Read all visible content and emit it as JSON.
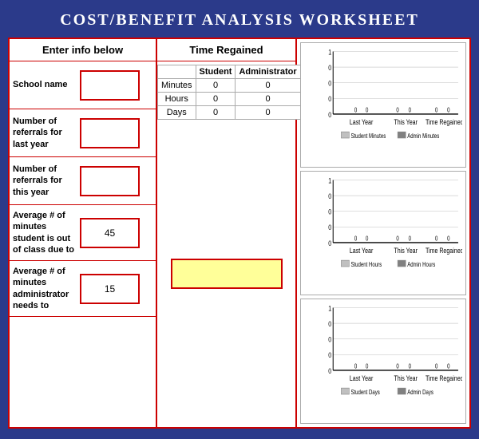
{
  "title": "COST/BENEFIT ANALYSIS WORKSHEET",
  "left_panel": {
    "header": "Enter info below",
    "fields": [
      {
        "label": "School name",
        "value": "",
        "has_input": true
      },
      {
        "label": "Number of referrals for last year",
        "value": "",
        "has_input": true
      },
      {
        "label": "Number of referrals for this year",
        "value": "",
        "has_input": true
      },
      {
        "label": "Average # of minutes student is out of class due to",
        "value": "45",
        "has_input": false
      },
      {
        "label": "Average # of minutes administrator needs to",
        "value": "15",
        "has_input": false
      }
    ]
  },
  "middle_panel": {
    "header": "Time Regained",
    "table": {
      "headers": [
        "",
        "Student",
        "Administrator"
      ],
      "rows": [
        {
          "label": "Minutes",
          "student": "0",
          "admin": "0"
        },
        {
          "label": "Hours",
          "student": "0",
          "admin": "0"
        },
        {
          "label": "Days",
          "student": "0",
          "admin": "0"
        }
      ]
    }
  },
  "charts": [
    {
      "id": "minutes-chart",
      "legend": [
        {
          "label": "Student Minutes",
          "color": "#c0c0c0"
        },
        {
          "label": "Admin Minutes",
          "color": "#808080"
        }
      ],
      "x_labels": [
        "Last Year",
        "This Year",
        "Time Regained"
      ],
      "y_max": 1,
      "y_labels": [
        "1",
        "0",
        "0",
        "0",
        "0"
      ],
      "student_values": [
        0,
        0,
        0
      ],
      "admin_values": [
        0,
        0,
        0
      ]
    },
    {
      "id": "hours-chart",
      "legend": [
        {
          "label": "Student Hours",
          "color": "#c0c0c0"
        },
        {
          "label": "Admin Hours",
          "color": "#808080"
        }
      ],
      "x_labels": [
        "Last Year",
        "This Year",
        "Time Regained"
      ],
      "y_max": 1,
      "student_values": [
        0,
        0,
        0
      ],
      "admin_values": [
        0,
        0,
        0
      ]
    },
    {
      "id": "days-chart",
      "legend": [
        {
          "label": "Student Days",
          "color": "#c0c0c0"
        },
        {
          "label": "Admin Days",
          "color": "#808080"
        }
      ],
      "x_labels": [
        "Last Year",
        "This Year",
        "Time Regained"
      ],
      "y_max": 1,
      "student_values": [
        0,
        0,
        0
      ],
      "admin_values": [
        0,
        0,
        0
      ]
    }
  ]
}
